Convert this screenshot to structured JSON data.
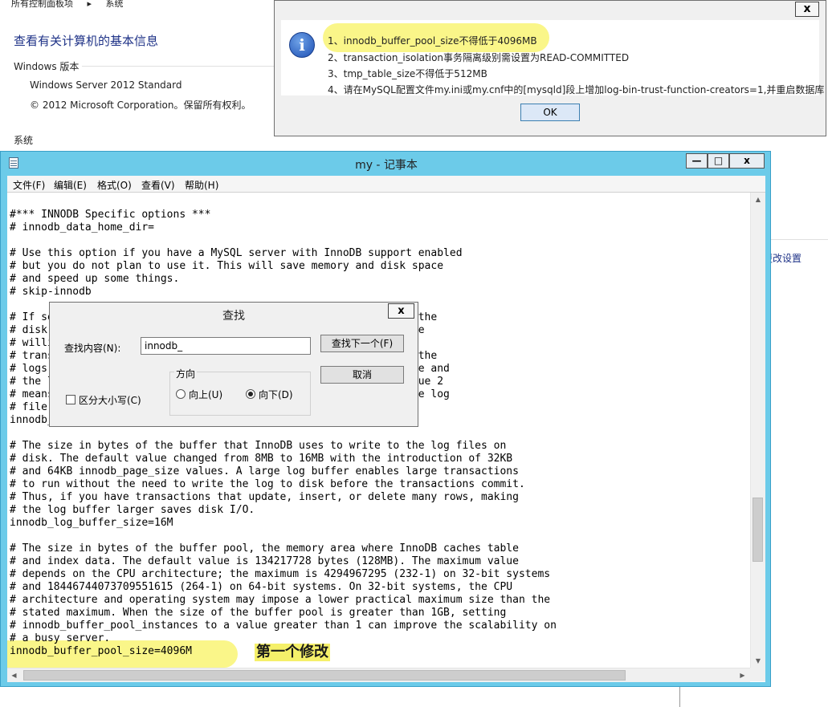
{
  "control_panel": {
    "breadcrumb": [
      "所有控制面板项",
      "系统"
    ],
    "title": "查看有关计算机的基本信息",
    "edition_label": "Windows 版本",
    "edition": "Windows Server 2012 Standard",
    "copyright": "© 2012 Microsoft Corporation。保留所有权利。",
    "system_label": "系统",
    "change_settings": "更改设置"
  },
  "message_box": {
    "close_label": "x",
    "icon": "info-icon",
    "lines": [
      "1、innodb_buffer_pool_size不得低于4096MB",
      "2、transaction_isolation事务隔离级别需设置为READ-COMMITTED",
      "3、tmp_table_size不得低于512MB",
      "4、请在MySQL配置文件my.ini或my.cnf中的[mysqld]段上增加log-bin-trust-function-creators=1,并重启数据库"
    ],
    "ok_label": "OK"
  },
  "notepad": {
    "title": "my - 记事本",
    "min_label": "—",
    "max_label": "□",
    "close_label": "x",
    "menus": [
      "文件(F)",
      "编辑(E)",
      "格式(O)",
      "查看(V)",
      "帮助(H)"
    ],
    "lines": [
      "#*** INNODB Specific options ***",
      "# innodb_data_home_dir=",
      "",
      "# Use this option if you have a MySQL server with InnoDB support enabled",
      "# but you do not plan to use it. This will save memory and disk space",
      "# and speed up some things.",
      "# skip-innodb",
      "",
      "# If set to 1, InnoDB will flush (fsync) the transaction logs to the",
      "# disk at each commit, which offers full ACID behavior. If you are",
      "# willing to compromise this safety, and you are running small",
      "# transactions, you may set this to 0 or 2 to reduce disk I/O to the",
      "# logs. Value 0 means that the log is only written to the log file and",
      "# the log file flushed to disk approximately once per second. Value 2",
      "# means the log is written to the log file at each commit, but the log",
      "# file is only flushed to disk approximately once per second.",
      "innodb_flush_log_at_trx_commit=1",
      "",
      "# The size in bytes of the buffer that InnoDB uses to write to the log files on",
      "# disk. The default value changed from 8MB to 16MB with the introduction of 32KB",
      "# and 64KB innodb_page_size values. A large log buffer enables large transactions",
      "# to run without the need to write the log to disk before the transactions commit.",
      "# Thus, if you have transactions that update, insert, or delete many rows, making",
      "# the log buffer larger saves disk I/O.",
      "innodb_log_buffer_size=16M",
      "",
      "# The size in bytes of the buffer pool, the memory area where InnoDB caches table",
      "# and index data. The default value is 134217728 bytes (128MB). The maximum value",
      "# depends on the CPU architecture; the maximum is 4294967295 (232-1) on 32-bit systems",
      "# and 18446744073709551615 (264-1) on 64-bit systems. On 32-bit systems, the CPU",
      "# architecture and operating system may impose a lower practical maximum size than the",
      "# stated maximum. When the size of the buffer pool is greater than 1GB, setting",
      "# innodb_buffer_pool_instances to a value greater than 1 can improve the scalability on",
      "# a busy server.",
      "innodb_buffer_pool_size=4096M"
    ],
    "annotation": "第一个修改"
  },
  "find_dialog": {
    "title": "查找",
    "close_label": "x",
    "find_label": "查找内容(N):",
    "find_value": "innodb_",
    "find_next_label": "查找下一个(F)",
    "cancel_label": "取消",
    "direction_label": "方向",
    "up_label": "向上(U)",
    "down_label": "向下(D)",
    "match_case_label": "区分大小写(C)"
  }
}
